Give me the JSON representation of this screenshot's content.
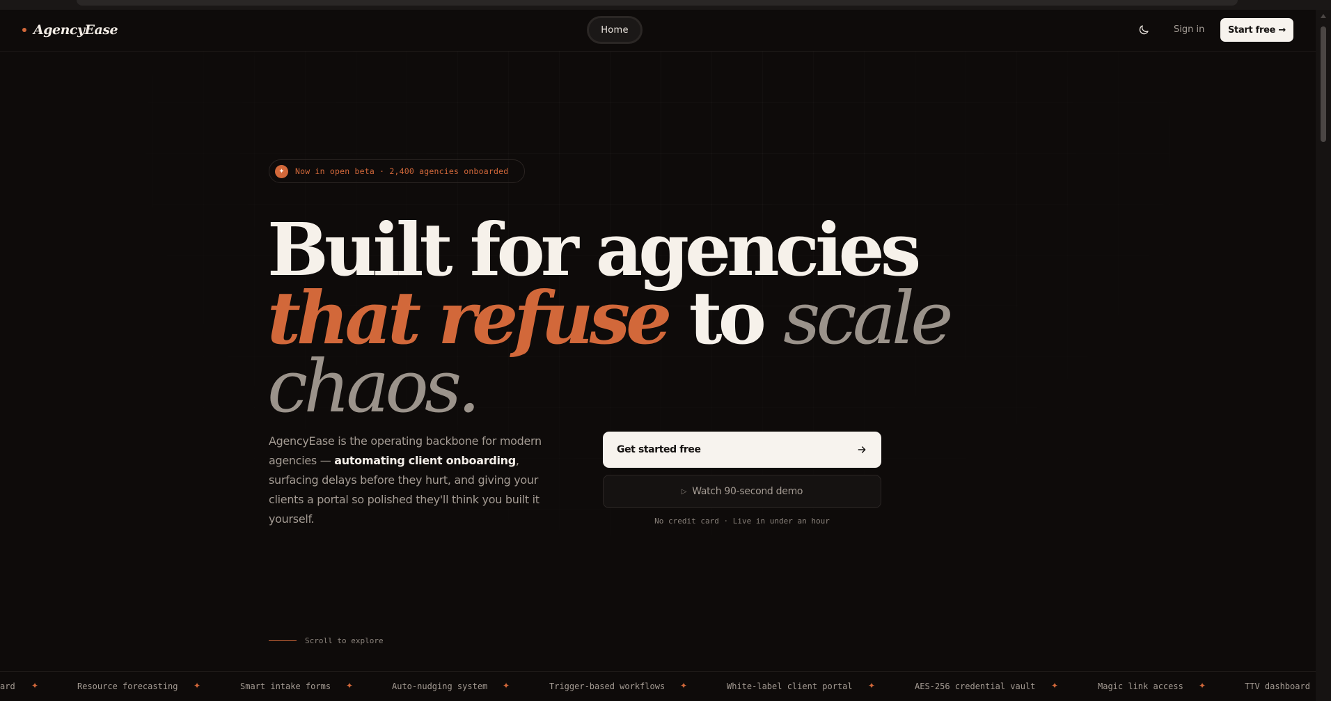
{
  "brand": {
    "name": "AgencyEase",
    "accent_color": "#d2683a"
  },
  "header": {
    "nav_home": "Home",
    "theme_icon": "moon-icon",
    "signin": "Sign in",
    "start_free": "Start free →"
  },
  "hero": {
    "badge_icon": "sparkle-icon",
    "badge_text": "Now in open beta · 2,400 agencies onboarded",
    "headline": {
      "line1": "Built for agencies",
      "line2_accent": "that refuse",
      "line2_white": "to",
      "line2_muted": "scale",
      "line3_muted": "chaos."
    },
    "description": {
      "part1": "AgencyEase is the operating backbone for modern agencies — ",
      "bold": "automating client onboarding",
      "part2": ", surfacing delays before they hurt, and giving your clients a portal so polished they'll think you built it yourself."
    },
    "cta_primary": "Get started free",
    "cta_primary_icon": "arrow-right-icon",
    "cta_secondary": "Watch 90-second demo",
    "cta_secondary_icon": "play-icon",
    "cta_note": "No credit card · Live in under an hour"
  },
  "scroll_hint": "Scroll to explore",
  "marquee": {
    "items": [
      "ard",
      "Resource forecasting",
      "Smart intake forms",
      "Auto-nudging system",
      "Trigger-based workflows",
      "White-label client portal",
      "AES-256 credential vault",
      "Magic link access",
      "TTV dashboard"
    ],
    "separator": "✦"
  }
}
